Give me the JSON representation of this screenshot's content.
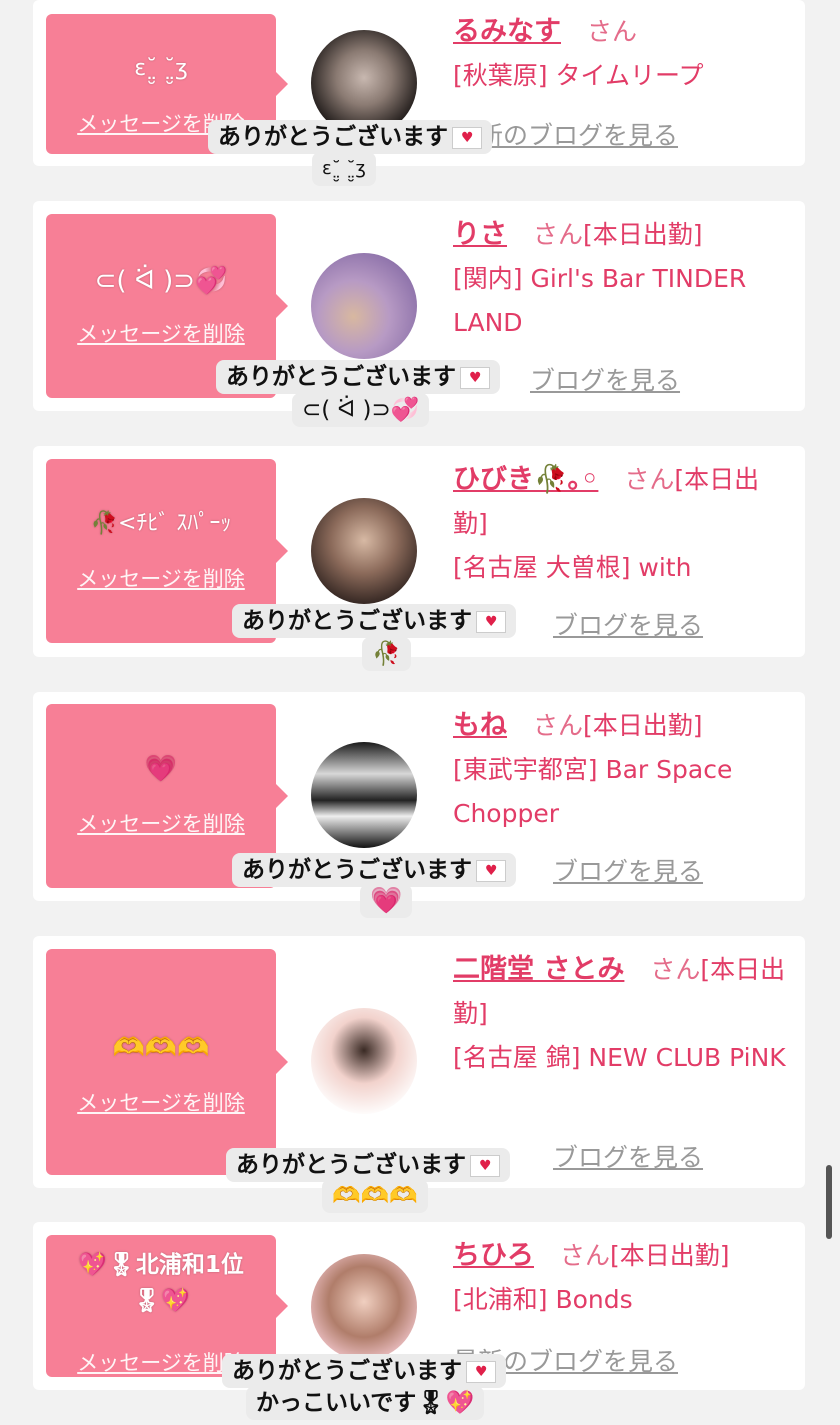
{
  "delete_label": "メッセージを削除",
  "blog_label": "最新のブログを見る",
  "blog_label_partial": "ブログを見る",
  "thanks": "ありがとうございます",
  "items": [
    {
      "message": "ɛ˘̤̮ ˘̤̮ʒ",
      "name": "るみなす",
      "san": "さん",
      "status": "",
      "shop": "[秋葉原] タイムリープ",
      "reply": "ɛ˘̤̮ ˘̤̮ʒ"
    },
    {
      "message": "⊂( ᐛ )⊃💞",
      "name": "りさ",
      "san": "さん",
      "status": "[本日出勤]",
      "shop": "[関内] Girl's Bar TINDER LAND",
      "reply": "⊂( ᐛ )⊃💞"
    },
    {
      "message": "🥀<ﾁﾋﾞ ｽﾊﾟｰｯ",
      "name": "ひびき🥀｡◦",
      "san": "さん",
      "status": "[本日出勤]",
      "shop": "[名古屋 大曽根] with",
      "reply": "🥀"
    },
    {
      "message": "💗",
      "name": "もね",
      "san": "さん",
      "status": "[本日出勤]",
      "shop": "[東武宇都宮] Bar Space Chopper",
      "reply": "💗"
    },
    {
      "message": "🫶🫶🫶",
      "name": "二階堂 さとみ",
      "san": "さん",
      "status": "[本日出勤]",
      "shop": "[名古屋 錦] NEW CLUB PiNK",
      "reply": "🫶🫶🫶"
    },
    {
      "message": "💖🎖北浦和1位🎖💖",
      "name": "ちひろ",
      "san": "さん",
      "status": "[本日出勤]",
      "shop": "[北浦和] Bonds",
      "reply": "かっこいいです🎖💖"
    }
  ]
}
